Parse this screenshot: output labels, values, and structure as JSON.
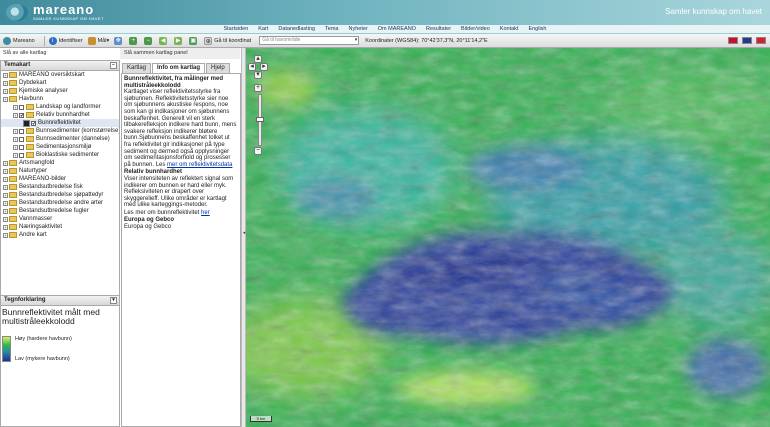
{
  "header": {
    "logo_name": "mareano",
    "logo_sub": "SAMLER KUNNSKAP OM HAVET",
    "slogan": "Samler kunnskap om havet"
  },
  "nav": {
    "items": [
      "Startsiden",
      "Kart",
      "Datanedlasting",
      "Tema",
      "Nyheter",
      "Om MAREANO",
      "Resultater",
      "Bilder/video",
      "Kontakt",
      "English"
    ]
  },
  "toolbar": {
    "mareano": "Mareano",
    "identify": "Identifiser",
    "measure": "Mål",
    "goto_label": "Gå til koordinat",
    "goto_placeholder": "Gå til havområde",
    "coords": "Koordinater (WGS84): 70°42'37,3\"N, 20°11'14,2\"E"
  },
  "left_header": "Slå av alle kartlag",
  "mid_header": "Slå sammen kartlag panel",
  "temakart": {
    "title": "Temakart",
    "items": [
      {
        "label": "MAREANO oversiktskart",
        "level": 0,
        "check": ""
      },
      {
        "label": "Dybdekart",
        "level": 0,
        "check": ""
      },
      {
        "label": "Kjemiske analyser",
        "level": 0,
        "check": ""
      },
      {
        "label": "Havbunn",
        "level": 0,
        "check": ""
      },
      {
        "label": "Landskap og landformer",
        "level": 1,
        "check": ""
      },
      {
        "label": "Relativ bunnhardhet",
        "level": 1,
        "check": "✔"
      },
      {
        "label": "Bunnreflektivitet",
        "level": 2,
        "check": "✔"
      },
      {
        "label": "Bunnsedimenter (kornstørrelse)",
        "level": 1,
        "check": ""
      },
      {
        "label": "Bunnsedimenter (dannelse)",
        "level": 1,
        "check": ""
      },
      {
        "label": "Sedimentasjonsmiljø",
        "level": 1,
        "check": ""
      },
      {
        "label": "Bioklastiske sedimenter",
        "level": 1,
        "check": ""
      },
      {
        "label": "Artsmangfold",
        "level": 0,
        "check": ""
      },
      {
        "label": "Naturtyper",
        "level": 0,
        "check": ""
      },
      {
        "label": "MAREANO-bilder",
        "level": 0,
        "check": ""
      },
      {
        "label": "Bestandsutbredelse fisk",
        "level": 0,
        "check": ""
      },
      {
        "label": "Bestandsutbredelse sjøpattedyr",
        "level": 0,
        "check": ""
      },
      {
        "label": "Bestandsutbredelse andre arter",
        "level": 0,
        "check": ""
      },
      {
        "label": "Bestandsutbredelse fugler",
        "level": 0,
        "check": ""
      },
      {
        "label": "Vannmasser",
        "level": 0,
        "check": ""
      },
      {
        "label": "Næringsaktivitet",
        "level": 0,
        "check": ""
      },
      {
        "label": "Andre kart",
        "level": 0,
        "check": ""
      }
    ]
  },
  "legend": {
    "title": "Tegnforklaring",
    "layer": "Bunnreflektivitet målt med multistråleekkolodd",
    "high": "Høy (hardere havbunn)",
    "low": "Lav (mykere havbunn)"
  },
  "tabs": [
    "Kartlag",
    "Info om kartlag",
    "Hjelp"
  ],
  "info": {
    "h1": "Bunnreflektivitet, fra målinger med multistråleekkolodd",
    "p1": "Kartlaget viser reflektivitetsstyrke fra sjøbunnen. Reflektivitetsstyrke sier noe om sjøbunnens akustiske respons, noe som kan gi indikasjoner om sjøbunnens beskaffenhet. Generelt vil en sterk tilbakerefleksjon indikere hard bunn, mens svakere refleksjon indikerer bløtere bunn.Sjøbunnens beskaffenhet tolket ut fra reflektivitet gir indikasjoner på type sediment og dermed også opplysninger om sedimentasjonsforhold og prosesser på bunnen. Les",
    "link1": "mer om reflektivitetsdata",
    "h2": "Relativ bunnhardhet",
    "p2": "Viser intensiteten av reflektert signal som indikerer om bunnen er hard eller myk. Refleksiviteten er drapert over skyggerelieff. Ulike områder er kartlagt med ulike karteggings-metoder.",
    "p2b": "Les mer om bunnreflektivitet",
    "link2": "her",
    "h3": "Europa og Gebco",
    "p3": "Europa og Gebco"
  },
  "map": {
    "scale": "5 km"
  },
  "colors": {
    "high": "#d6f064",
    "mid": "#28b84b",
    "low": "#1e2f97",
    "header": "#3f8a9c"
  }
}
